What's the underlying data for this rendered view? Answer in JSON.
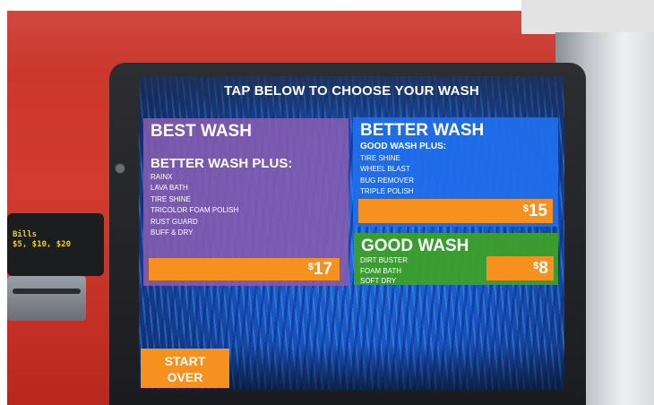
{
  "screen": {
    "title": "TAP BELOW TO CHOOSE YOUR WASH"
  },
  "packages": {
    "best": {
      "name": "BEST WASH",
      "subtitle": "BETTER WASH PLUS:",
      "features": [
        "RAINX",
        "LAVA BATH",
        "TIRE SHINE",
        "TRICOLOR FOAM POLISH",
        "RUST GUARD",
        "BUFF & DRY"
      ],
      "currency": "$",
      "price": "17",
      "color": "#8a5cb0"
    },
    "better": {
      "name": "BETTER WASH",
      "subtitle": "GOOD WASH PLUS:",
      "features": [
        "TIRE SHINE",
        "WHEEL BLAST",
        "BUG REMOVER",
        "TRIPLE POLISH"
      ],
      "currency": "$",
      "price": "15",
      "color": "#206eeb"
    },
    "good": {
      "name": "GOOD WASH",
      "features": [
        "DIRT BUSTER",
        "FOAM BATH",
        "SOFT DRY"
      ],
      "currency": "$",
      "price": "8",
      "color": "#3ca028"
    }
  },
  "controls": {
    "start_over_line1": "START",
    "start_over_line2": "OVER"
  },
  "bill_acceptor": {
    "line1": "Bills",
    "line2": "$5, $10, $20"
  },
  "colors": {
    "accent_orange": "#f6901e",
    "kiosk_red": "#c9342a"
  }
}
